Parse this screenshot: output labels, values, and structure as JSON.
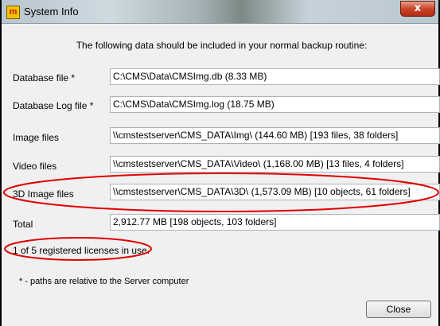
{
  "window": {
    "title": "System Info",
    "app_icon_glyph": "m",
    "close_glyph": "x"
  },
  "intro": "The following data should be included in your normal backup routine:",
  "rows": [
    {
      "label": "Database file  *",
      "value": "C:\\CMS\\Data\\CMSImg.db (8.33 MB)"
    },
    {
      "label": "Database Log file  *",
      "value": "C:\\CMS\\Data\\CMSImg.log (18.75 MB)"
    },
    {
      "label": "Image files",
      "value": "\\\\cmstestserver\\CMS_DATA\\Img\\ (144.60 MB) [193 files, 38 folders]"
    },
    {
      "label": "Video files",
      "value": "\\\\cmstestserver\\CMS_DATA\\Video\\ (1,168.00 MB) [13 files, 4 folders]"
    },
    {
      "label": "3D Image files",
      "value": "\\\\cmstestserver\\CMS_DATA\\3D\\ (1,573.09 MB) [10 objects, 61 folders]"
    },
    {
      "label": "Total",
      "value": "2,912.77 MB [198 objects, 103 folders]"
    }
  ],
  "license_status": "1 of 5 registered licenses in use.",
  "note": "* - paths are relative to the Server computer",
  "buttons": {
    "close_label": "Close"
  },
  "colors": {
    "annotation": "#e00000"
  },
  "icons": {
    "app": "app-logo-icon",
    "close": "close-icon"
  }
}
